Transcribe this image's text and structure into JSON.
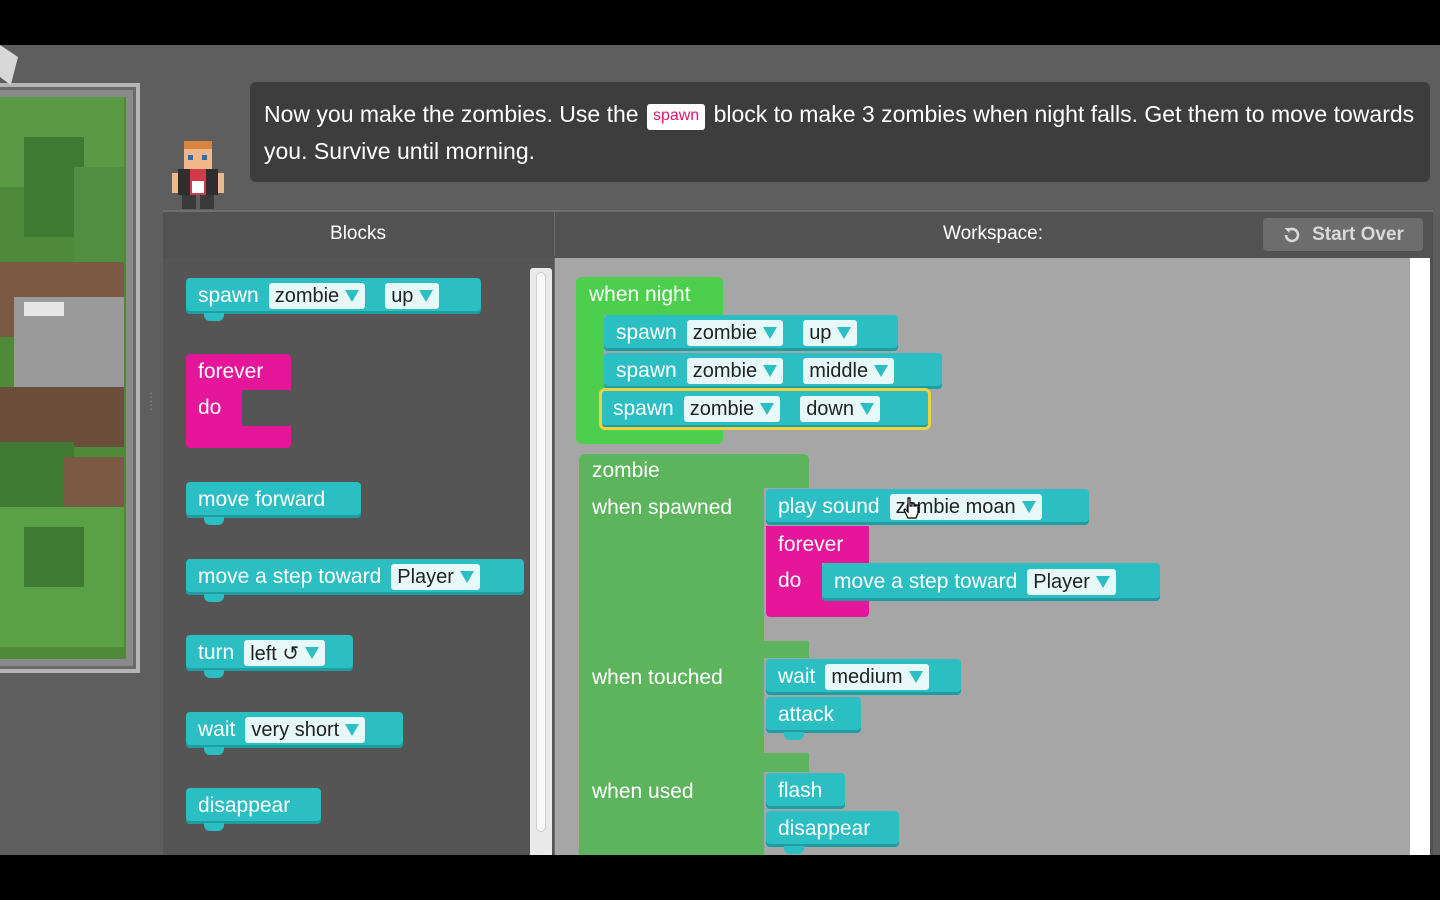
{
  "instructions": {
    "before": "Now you make the zombies. Use the",
    "keyword": "spawn",
    "after": "block to make 3 zombies when night falls. Get them to move towards you. Survive until morning."
  },
  "headers": {
    "blocks": "Blocks",
    "workspace": "Workspace:",
    "start_over": "Start Over"
  },
  "toolbox": {
    "spawn": {
      "label": "spawn",
      "mob": "zombie",
      "dir": "up"
    },
    "forever": {
      "label": "forever",
      "do": "do"
    },
    "move_forward": "move forward",
    "move_step": {
      "label": "move a step toward",
      "target": "Player"
    },
    "turn": {
      "label": "turn",
      "dir": "left ↺"
    },
    "wait": {
      "label": "wait",
      "duration": "very short"
    },
    "disappear": "disappear"
  },
  "workspace": {
    "when_night": "when night",
    "spawns": [
      {
        "label": "spawn",
        "mob": "zombie",
        "dir": "up"
      },
      {
        "label": "spawn",
        "mob": "zombie",
        "dir": "middle"
      },
      {
        "label": "spawn",
        "mob": "zombie",
        "dir": "down"
      }
    ],
    "zombie": {
      "title": "zombie",
      "when_spawned": "when spawned",
      "play_sound": {
        "label": "play sound",
        "sound": "zombie moan"
      },
      "forever": "forever",
      "do": "do",
      "move_step": {
        "label": "move a step toward",
        "target": "Player"
      },
      "when_touched": "when touched",
      "wait": {
        "label": "wait",
        "duration": "medium"
      },
      "attack": "attack",
      "when_used": "when used",
      "flash": "flash",
      "disappear": "disappear"
    }
  },
  "colors": {
    "teal": "#2bbfc4",
    "pink": "#e5169a",
    "green": "#4ccf4c",
    "zombie_green": "#5cb55c",
    "selected_outline": "#f2d23c"
  }
}
